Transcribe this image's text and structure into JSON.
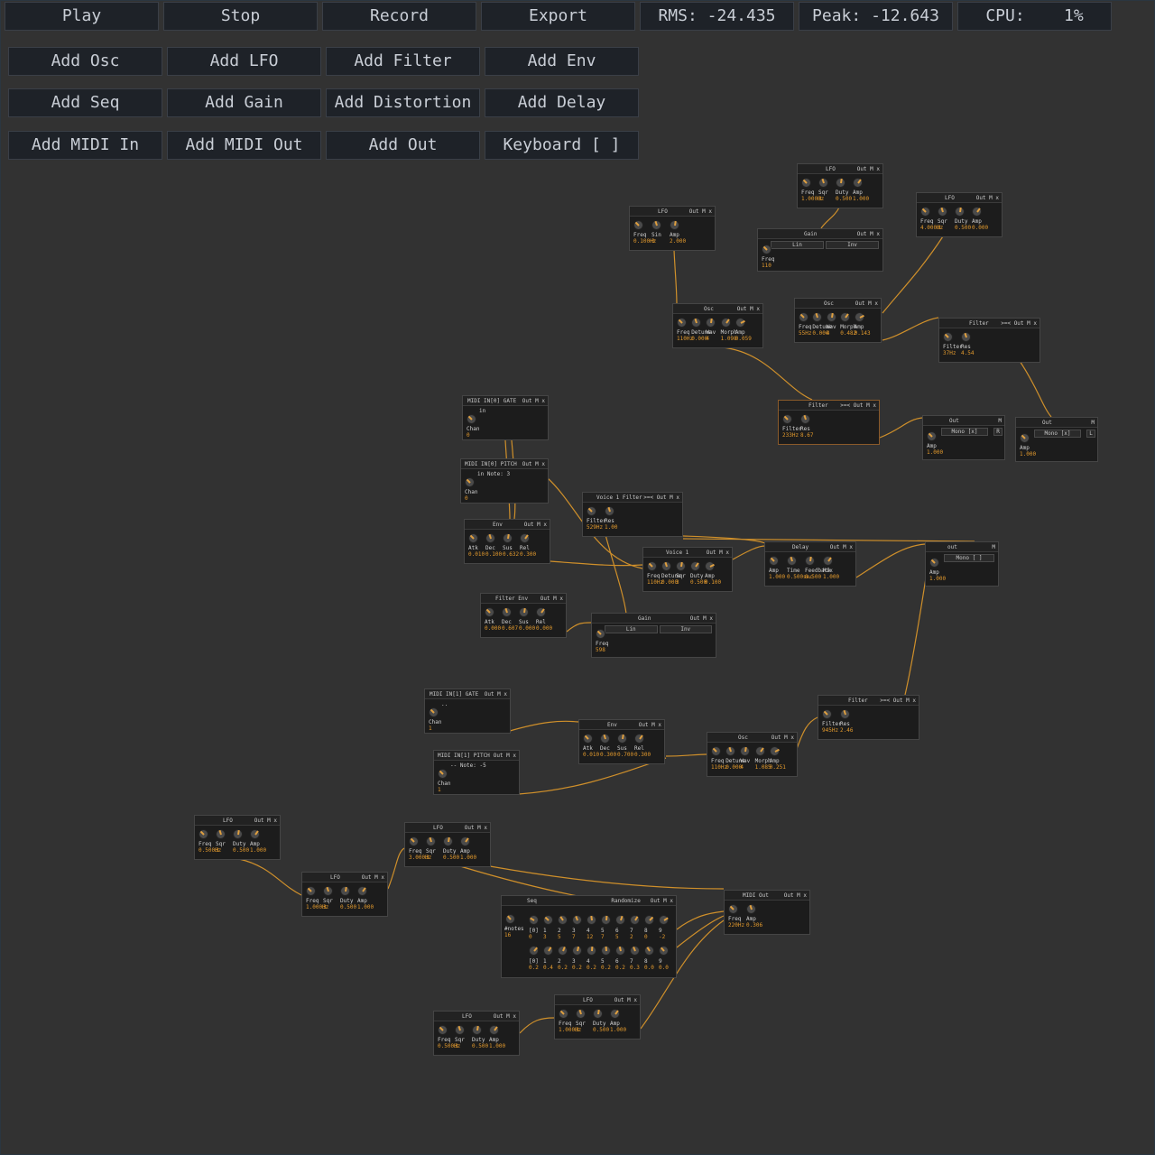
{
  "toolbar": {
    "row1": [
      "Play",
      "Stop",
      "Record",
      "Export"
    ],
    "rms": "RMS: -24.435",
    "peak": "Peak: -12.643",
    "cpu": "CPU:    1%",
    "row2": [
      "Add Osc",
      "Add LFO",
      "Add Filter",
      "Add Env"
    ],
    "row3": [
      "Add Seq",
      "Add Gain",
      "Add Distortion",
      "Add Delay"
    ],
    "row4": [
      "Add MIDI In",
      "Add MIDI Out",
      "Add Out",
      "Keyboard [ ]"
    ]
  },
  "colors": {
    "wire": "#e09a2a",
    "accent": "#e39a2d",
    "background": "#323232",
    "module": "#1c1c1c"
  },
  "modules": [
    {
      "title": "LFO",
      "controls": "Out M x",
      "knobs": [
        {
          "l": "Freq",
          "v": "1.000Hz"
        },
        {
          "l": "Sqr",
          "v": "3"
        },
        {
          "l": "Duty",
          "v": "0.500"
        },
        {
          "l": "Amp",
          "v": "1.000"
        }
      ]
    },
    {
      "title": "LFO",
      "controls": "Out M x",
      "knobs": [
        {
          "l": "Freq",
          "v": "4.000Hz"
        },
        {
          "l": "Sqr",
          "v": "3"
        },
        {
          "l": "Duty",
          "v": "0.500"
        },
        {
          "l": "Amp",
          "v": "0.000"
        }
      ]
    },
    {
      "title": "LFO",
      "controls": "Out M x",
      "knobs": [
        {
          "l": "Freq",
          "v": "0.100Hz"
        },
        {
          "l": "Sin",
          "v": "0"
        },
        {
          "l": "Amp",
          "v": "2.000"
        }
      ]
    },
    {
      "title": "Gain",
      "controls": "Out M x",
      "boxes": [
        "Lin",
        "Inv"
      ],
      "knobs": [
        {
          "l": "Freq",
          "v": "110"
        }
      ]
    },
    {
      "title": "Osc",
      "controls": "Out M x",
      "knobs": [
        {
          "l": "Freq",
          "v": "110Hz"
        },
        {
          "l": "Detune",
          "v": "0.000"
        },
        {
          "l": "Wav",
          "v": "4"
        },
        {
          "l": "Morph",
          "v": "1.098"
        },
        {
          "l": "Amp",
          "v": "0.059"
        }
      ]
    },
    {
      "title": "Osc",
      "controls": "Out M x",
      "knobs": [
        {
          "l": "Freq",
          "v": "55Hz"
        },
        {
          "l": "Detune",
          "v": "0.000"
        },
        {
          "l": "Wav",
          "v": "4"
        },
        {
          "l": "Morph",
          "v": "0.482"
        },
        {
          "l": "Amp",
          "v": "0.143"
        }
      ]
    },
    {
      "title": "Filter",
      "controls": ">=< Out M x",
      "knobs": [
        {
          "l": "Filter",
          "v": "37Hz"
        },
        {
          "l": "Res",
          "v": "4.54"
        }
      ]
    },
    {
      "title": "Filter",
      "controls": ">=< Out M x",
      "knobs": [
        {
          "l": "Filter",
          "v": "233Hz"
        },
        {
          "l": "Res",
          "v": "8.67"
        }
      ]
    },
    {
      "title": "Out",
      "controls": "M",
      "boxes": [
        "Mono [x]",
        "R"
      ],
      "knobs": [
        {
          "l": "Amp",
          "v": "1.000"
        }
      ]
    },
    {
      "title": "Out",
      "controls": "M",
      "boxes": [
        "Mono [x]",
        "L"
      ],
      "knobs": [
        {
          "l": "Amp",
          "v": "1.000"
        }
      ]
    },
    {
      "title": "MIDI IN[0] GATE",
      "controls": "Out M x",
      "note": "in",
      "knobs": [
        {
          "l": "Chan",
          "v": "0"
        }
      ]
    },
    {
      "title": "MIDI IN[0] PITCH",
      "controls": "Out M x",
      "note": "in Note: 3",
      "knobs": [
        {
          "l": "Chan",
          "v": "0"
        }
      ]
    },
    {
      "title": "Voice 1 Filter",
      "controls": ">=< Out M x",
      "knobs": [
        {
          "l": "Filter",
          "v": "529Hz"
        },
        {
          "l": "Res",
          "v": "1.00"
        }
      ]
    },
    {
      "title": "Env",
      "controls": "Out M x",
      "knobs": [
        {
          "l": "Atk",
          "v": "0.010"
        },
        {
          "l": "Dec",
          "v": "0.100"
        },
        {
          "l": "Sus",
          "v": "0.632"
        },
        {
          "l": "Rel",
          "v": "0.300"
        }
      ]
    },
    {
      "title": "Voice 1",
      "controls": "Out M x",
      "knobs": [
        {
          "l": "Freq",
          "v": "110Hz"
        },
        {
          "l": "Detune",
          "v": "0.000"
        },
        {
          "l": "Sqr",
          "v": "3"
        },
        {
          "l": "Duty",
          "v": "0.500"
        },
        {
          "l": "Amp",
          "v": "0.100"
        }
      ]
    },
    {
      "title": "Delay",
      "controls": "Out M x",
      "knobs": [
        {
          "l": "Amp",
          "v": "1.000"
        },
        {
          "l": "Time",
          "v": "0.500sec"
        },
        {
          "l": "Feedback",
          "v": "0.500"
        },
        {
          "l": "Mix",
          "v": "1.000"
        }
      ]
    },
    {
      "title": "out",
      "controls": "M",
      "boxes": [
        "Mono [ ]"
      ],
      "knobs": [
        {
          "l": "Amp",
          "v": "1.000"
        }
      ]
    },
    {
      "title": "Filter Env",
      "controls": "Out M x",
      "knobs": [
        {
          "l": "Atk",
          "v": "0.000"
        },
        {
          "l": "Dec",
          "v": "0.607"
        },
        {
          "l": "Sus",
          "v": "0.000"
        },
        {
          "l": "Rel",
          "v": "0.000"
        }
      ]
    },
    {
      "title": "Gain",
      "controls": "Out M x",
      "boxes": [
        "Lin",
        "Inv"
      ],
      "knobs": [
        {
          "l": "Freq",
          "v": "598"
        }
      ]
    },
    {
      "title": "MIDI IN[1] GATE",
      "controls": "Out M x",
      "note": "..",
      "knobs": [
        {
          "l": "Chan",
          "v": "1"
        }
      ]
    },
    {
      "title": "MIDI IN[1] PITCH",
      "controls": "Out M x",
      "note": "-- Note: -5",
      "knobs": [
        {
          "l": "Chan",
          "v": "1"
        }
      ]
    },
    {
      "title": "Env",
      "controls": "Out M x",
      "knobs": [
        {
          "l": "Atk",
          "v": "0.010"
        },
        {
          "l": "Dec",
          "v": "0.300"
        },
        {
          "l": "Sus",
          "v": "0.700"
        },
        {
          "l": "Rel",
          "v": "0.300"
        }
      ]
    },
    {
      "title": "Osc",
      "controls": "Out M x",
      "knobs": [
        {
          "l": "Freq",
          "v": "110Hz"
        },
        {
          "l": "Detune",
          "v": "0.000"
        },
        {
          "l": "Wav",
          "v": "4"
        },
        {
          "l": "Morph",
          "v": "1.085"
        },
        {
          "l": "Amp",
          "v": "0.251"
        }
      ]
    },
    {
      "title": "Filter",
      "controls": ">=< Out M x",
      "knobs": [
        {
          "l": "Filter",
          "v": "945Hz"
        },
        {
          "l": "Res",
          "v": "2.46"
        }
      ]
    },
    {
      "title": "LFO",
      "controls": "Out M x",
      "knobs": [
        {
          "l": "Freq",
          "v": "0.500Hz"
        },
        {
          "l": "Sqr",
          "v": "3"
        },
        {
          "l": "Duty",
          "v": "0.500"
        },
        {
          "l": "Amp",
          "v": "1.000"
        }
      ]
    },
    {
      "title": "LFO",
      "controls": "Out M x",
      "knobs": [
        {
          "l": "Freq",
          "v": "1.000Hz"
        },
        {
          "l": "Sqr",
          "v": "3"
        },
        {
          "l": "Duty",
          "v": "0.500"
        },
        {
          "l": "Amp",
          "v": "1.000"
        }
      ]
    },
    {
      "title": "LFO",
      "controls": "Out M x",
      "knobs": [
        {
          "l": "Freq",
          "v": "3.000Hz"
        },
        {
          "l": "Sqr",
          "v": "3"
        },
        {
          "l": "Duty",
          "v": "0.500"
        },
        {
          "l": "Amp",
          "v": "1.000"
        }
      ]
    },
    {
      "title": "Seq",
      "controls": "Randomize   Out M x",
      "seq": true,
      "knobs": [
        {
          "l": "#notes",
          "v": "16"
        }
      ],
      "steps": [
        "[0]",
        "1",
        "2",
        "3",
        "4",
        "5",
        "6",
        "7",
        "8",
        "9"
      ],
      "notes": [
        "0",
        "3",
        "5",
        "7",
        "12",
        "7",
        "5",
        "2",
        "0",
        "-2"
      ],
      "gates": [
        "0.2",
        "0.4",
        "0.2",
        "0.2",
        "0.2",
        "0.2",
        "0.2",
        "0.3",
        "0.0",
        "0.0"
      ]
    },
    {
      "title": "MIDI Out",
      "controls": "Out M x",
      "knobs": [
        {
          "l": "Freq",
          "v": "220Hz"
        },
        {
          "l": "Amp",
          "v": "0.306"
        }
      ]
    },
    {
      "title": "LFO",
      "controls": "Out M x",
      "knobs": [
        {
          "l": "Freq",
          "v": "1.000Hz"
        },
        {
          "l": "Sqr",
          "v": "3"
        },
        {
          "l": "Duty",
          "v": "0.500"
        },
        {
          "l": "Amp",
          "v": "1.000"
        }
      ]
    },
    {
      "title": "LFO",
      "controls": "Out M x",
      "knobs": [
        {
          "l": "Freq",
          "v": "0.500Hz"
        },
        {
          "l": "Sqr",
          "v": "3"
        },
        {
          "l": "Duty",
          "v": "0.500"
        },
        {
          "l": "Amp",
          "v": "1.000"
        }
      ]
    }
  ]
}
